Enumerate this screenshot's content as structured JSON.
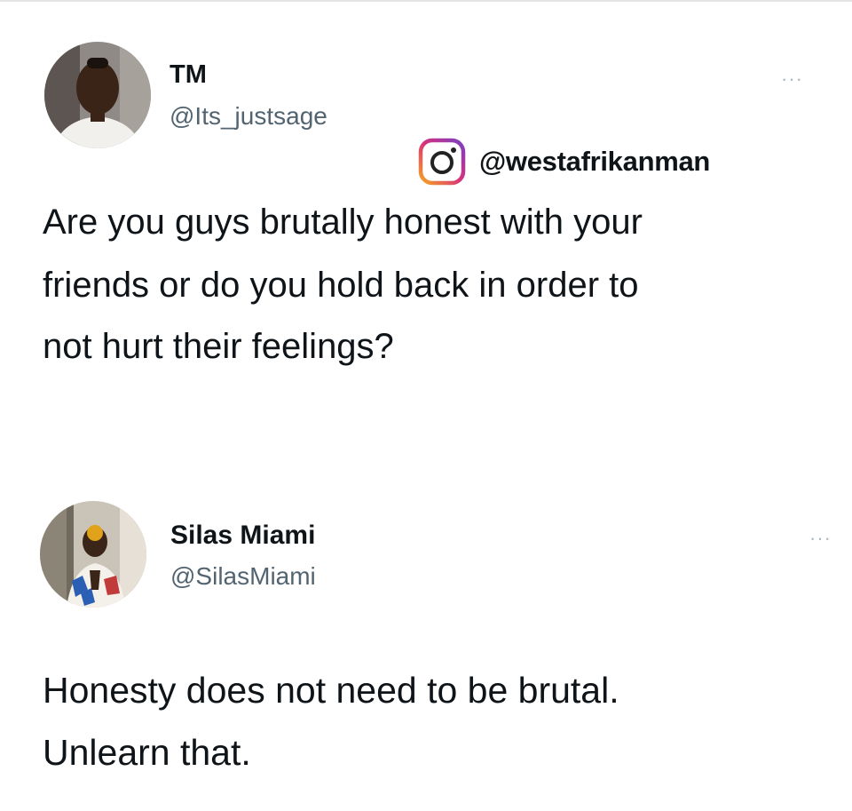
{
  "tweet1": {
    "name": "TM",
    "handle": "@Its_justsage",
    "text_line1": "Are you guys brutally honest with your",
    "text_line2": "friends or do you hold back in order to",
    "text_line3": "not hurt their feelings?",
    "more_label": "···"
  },
  "watermark": {
    "icon": "instagram-icon",
    "handle": "@westafrikanman"
  },
  "tweet2": {
    "name": "Silas Miami",
    "handle": "@SilasMiami",
    "text_line1": "Honesty does not need to be brutal.",
    "text_line2": "Unlearn that.",
    "more_label": "···"
  }
}
